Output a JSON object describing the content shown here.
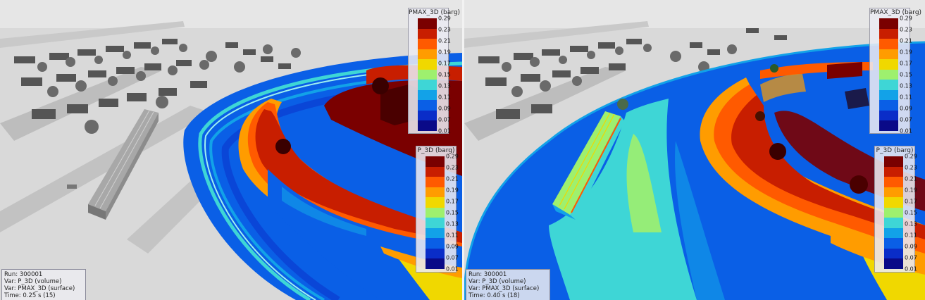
{
  "frames": [
    {
      "id": "left",
      "pmax_colorbar": {
        "title": "PMAX_3D (barg)",
        "ticks": [
          "0.29",
          "0.23",
          "0.21",
          "0.19",
          "0.17",
          "0.15",
          "0.13",
          "0.11",
          "0.09",
          "0.07",
          "0.01"
        ]
      },
      "p_colorbar": {
        "title": "P_3D (barg)",
        "ticks": [
          "0.29",
          "0.23",
          "0.21",
          "0.19",
          "0.17",
          "0.15",
          "0.13",
          "0.11",
          "0.09",
          "0.07",
          "0.01"
        ]
      },
      "info": {
        "run": "Run: 300001",
        "var_volume": "Var: P_3D (volume)",
        "var_surface": "Var: PMAX_3D (surface)",
        "time": "Time: 0.25 s (15)"
      }
    },
    {
      "id": "right",
      "pmax_colorbar": {
        "title": "PMAX_3D (barg)",
        "ticks": [
          "0.29",
          "0.23",
          "0.21",
          "0.19",
          "0.17",
          "0.15",
          "0.13",
          "0.11",
          "0.09",
          "0.07",
          "0.01"
        ]
      },
      "p_colorbar": {
        "title": "P_3D (barg)",
        "ticks": [
          "0.29",
          "0.23",
          "0.21",
          "0.19",
          "0.17",
          "0.15",
          "0.13",
          "0.11",
          "0.09",
          "0.07",
          "0.01"
        ]
      },
      "info": {
        "run": "Run: 300001",
        "var_volume": "Var: P_3D (volume)",
        "var_surface": "Var: PMAX_3D (surface)",
        "time": "Time: 0.40 s (18)"
      }
    }
  ],
  "colormap": [
    "#7a0000",
    "#c81e00",
    "#ff5a00",
    "#ff9c00",
    "#f0d800",
    "#9ef06e",
    "#3ed6d6",
    "#12a2e8",
    "#0a5fe6",
    "#0a2dc8",
    "#0a0a88"
  ]
}
